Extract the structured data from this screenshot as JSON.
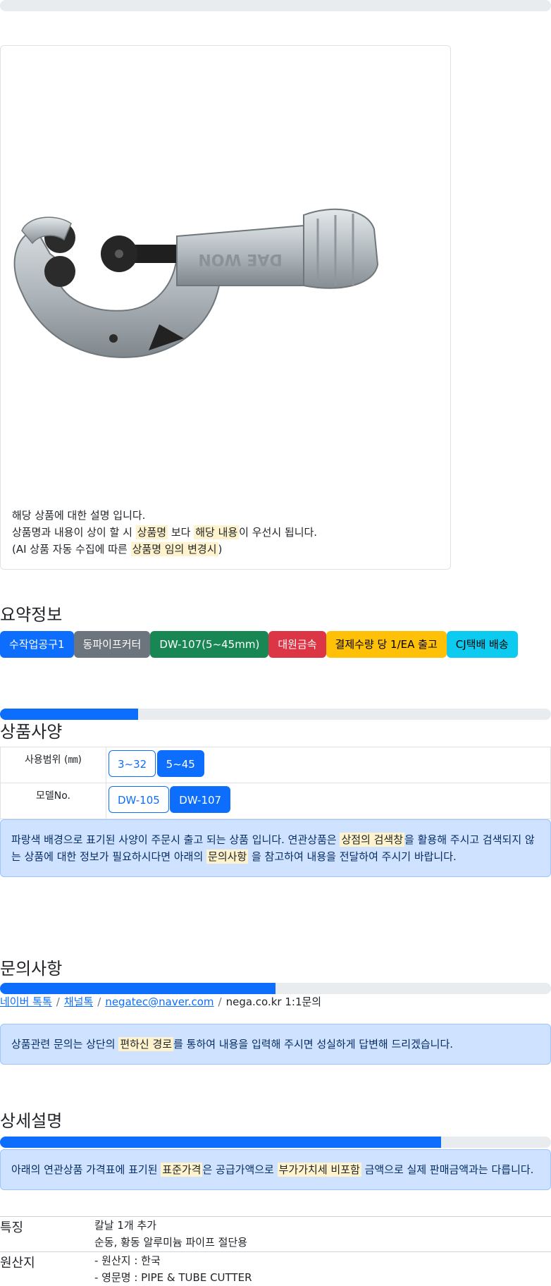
{
  "colors": {
    "primary": "#0d6efd",
    "secondary": "#6c757d",
    "success": "#198754",
    "danger": "#dc3545",
    "warning": "#ffc107",
    "info": "#0dcaf0",
    "alert_bg": "#cfe2ff",
    "highlight": "#fff3cd"
  },
  "card": {
    "image_icon": "pipe-cutter-image",
    "image_brand_text": "DAE WON",
    "line1": "해당 상품에 대한 설명 입니다.",
    "line2_a": "상품명과 내용이 상이 할 시 ",
    "line2_mark1": "상품명",
    "line2_b": " 보다 ",
    "line2_mark2": "해당 내용",
    "line2_c": "이 우선시 됩니다.",
    "line3_a": "(AI 상품 자동 수집에 따른 ",
    "line3_mark": "상품명 임의 변경시",
    "line3_b": ")"
  },
  "summary": {
    "title": "요약정보",
    "badges": [
      "수작업공구1",
      "동파이프커터",
      "DW-107(5~45mm)",
      "대원금속",
      "결제수량 당 1/EA 출고",
      "CJ택배 배송"
    ]
  },
  "specs": {
    "progress": 0.25,
    "title": "상품사양",
    "rows": [
      {
        "label": "사용범위 (㎜)",
        "options": [
          "3~32",
          "5~45"
        ],
        "selected": 1
      },
      {
        "label": "모델No.",
        "options": [
          "DW-105",
          "DW-107"
        ],
        "selected": 1
      }
    ],
    "notice_a": "파랑색 배경으로 표기된 사양이 주문시 출고 되는 상품 입니다. 연관상품은 ",
    "notice_mark1": "상점의 검색창",
    "notice_b": "을 활용해 주시고 검색되지 않",
    "notice_c": "는 상품에 대한 정보가 필요하시다면 아래의 ",
    "notice_mark2": "문의사항",
    "notice_d": " 을 참고하여 내용을 전달하여 주시기 바랍니다."
  },
  "inquiry": {
    "title": "문의사항",
    "progress": 0.5,
    "links": [
      "네이버 톡톡",
      "채널톡",
      "negatec@naver.com"
    ],
    "plain": "nega.co.kr 1:1문의",
    "separator": "/",
    "notice_a": "상품관련 문의는 상단의 ",
    "notice_mark": "편하신 경로",
    "notice_b": "를 통하여 내용을 입력해 주시면 성실하게 답변해 드리겠습니다."
  },
  "detail": {
    "title": "상세설명",
    "progress": 0.8,
    "notice_a": "아래의 연관상품 가격표에 표기된 ",
    "notice_mark1": "표준가격",
    "notice_b": "은 공급가액으로 ",
    "notice_mark2": "부가가치세 비포함",
    "notice_c": " 금액으로 실제 판매금액과는 다릅니다."
  },
  "features": {
    "label": "특징",
    "lines": [
      "칼날 1개 추가",
      "순동, 황동 알루미늄 파이프 절단용"
    ]
  },
  "origin": {
    "label": "원산지",
    "lines": [
      "- 원산지 : 한국",
      "- 영문명 : PIPE & TUBE CUTTER"
    ]
  }
}
